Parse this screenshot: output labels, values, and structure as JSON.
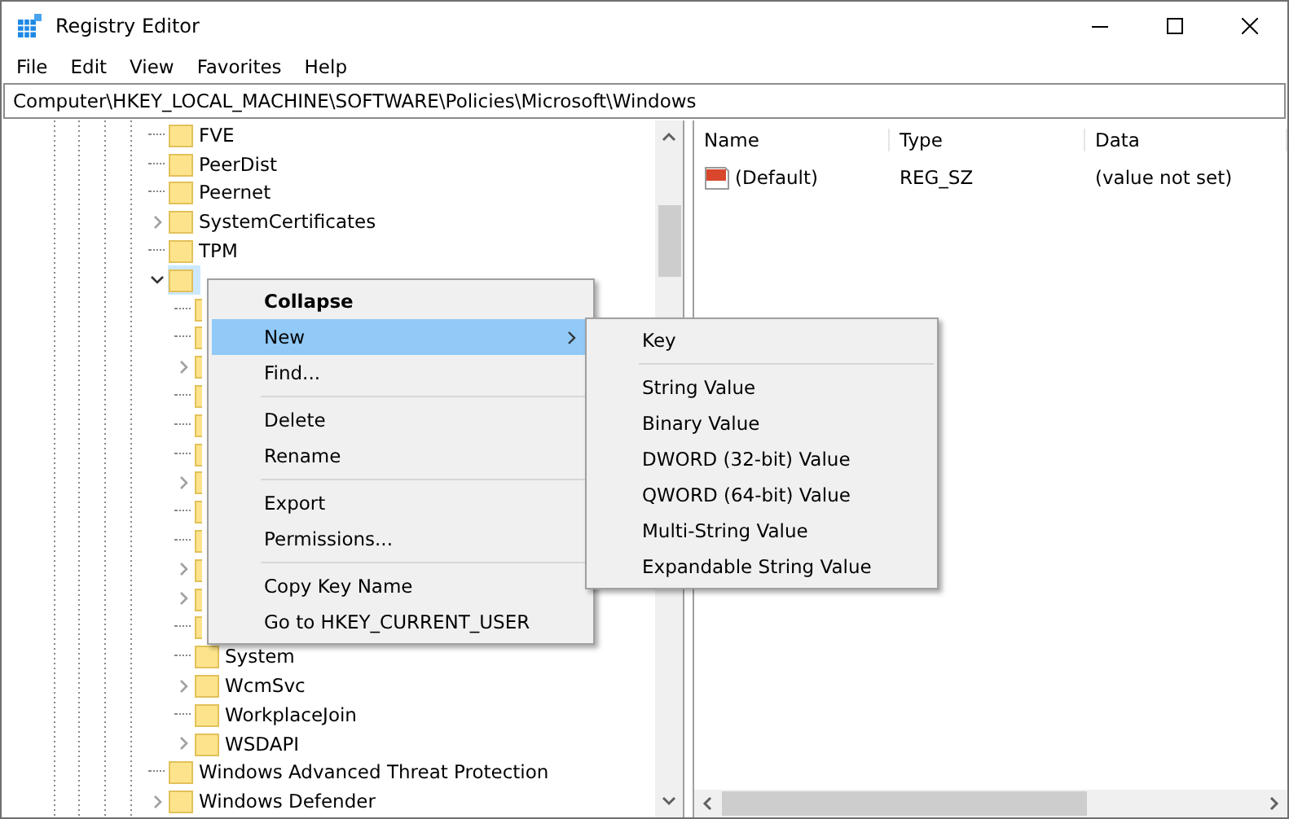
{
  "window": {
    "title": "Registry Editor"
  },
  "menu_bar": [
    "File",
    "Edit",
    "View",
    "Favorites",
    "Help"
  ],
  "address": "Computer\\HKEY_LOCAL_MACHINE\\SOFTWARE\\Policies\\Microsoft\\Windows",
  "tree": [
    {
      "label": "FVE",
      "has_children": false
    },
    {
      "label": "PeerDist",
      "has_children": false
    },
    {
      "label": "Peernet",
      "has_children": false
    },
    {
      "label": "SystemCertificates",
      "has_children": true,
      "expanded": false
    },
    {
      "label": "TPM",
      "has_children": false
    },
    {
      "selected": true,
      "has_children": true,
      "expanded": true,
      "children": [
        {
          "has_children": false
        },
        {
          "has_children": false
        },
        {
          "has_children": true,
          "expanded": false
        },
        {
          "has_children": false
        },
        {
          "has_children": false
        },
        {
          "has_children": false
        },
        {
          "has_children": true,
          "expanded": false
        },
        {
          "has_children": false
        },
        {
          "has_children": false
        },
        {
          "has_children": true,
          "expanded": false
        },
        {
          "has_children": true,
          "expanded": false
        },
        {
          "has_children": false
        },
        {
          "label": "System",
          "has_children": false
        },
        {
          "label": "WcmSvc",
          "has_children": true,
          "expanded": false
        },
        {
          "label": "WorkplaceJoin",
          "has_children": false
        },
        {
          "label": "WSDAPI",
          "has_children": true,
          "expanded": false
        }
      ]
    },
    {
      "label": "Windows Advanced Threat Protection",
      "has_children": false
    },
    {
      "label": "Windows Defender",
      "has_children": true,
      "expanded": false
    }
  ],
  "values": {
    "columns": [
      "Name",
      "Type",
      "Data"
    ],
    "rows": [
      {
        "name": "(Default)",
        "type": "REG_SZ",
        "data": "(value not set)"
      }
    ]
  },
  "context_menu": [
    {
      "kind": "item",
      "label": "Collapse",
      "bold": true,
      "selected": false
    },
    {
      "kind": "submenu",
      "label": "New",
      "bold": false,
      "selected": true
    },
    {
      "kind": "item",
      "label": "Find...",
      "bold": false,
      "selected": false
    },
    {
      "kind": "separator"
    },
    {
      "kind": "item",
      "label": "Delete",
      "bold": false,
      "selected": false
    },
    {
      "kind": "item",
      "label": "Rename",
      "bold": false,
      "selected": false
    },
    {
      "kind": "separator"
    },
    {
      "kind": "item",
      "label": "Export",
      "bold": false,
      "selected": false
    },
    {
      "kind": "item",
      "label": "Permissions...",
      "bold": false,
      "selected": false
    },
    {
      "kind": "separator"
    },
    {
      "kind": "item",
      "label": "Copy Key Name",
      "bold": false,
      "selected": false
    },
    {
      "kind": "item",
      "label": "Go to HKEY_CURRENT_USER",
      "bold": false,
      "selected": false
    }
  ],
  "submenu": [
    {
      "kind": "item",
      "label": "Key"
    },
    {
      "kind": "separator"
    },
    {
      "kind": "item",
      "label": "String Value"
    },
    {
      "kind": "item",
      "label": "Binary Value"
    },
    {
      "kind": "item",
      "label": "DWORD (32-bit) Value"
    },
    {
      "kind": "item",
      "label": "QWORD (64-bit) Value"
    },
    {
      "kind": "item",
      "label": "Multi-String Value"
    },
    {
      "kind": "item",
      "label": "Expandable String Value"
    }
  ]
}
